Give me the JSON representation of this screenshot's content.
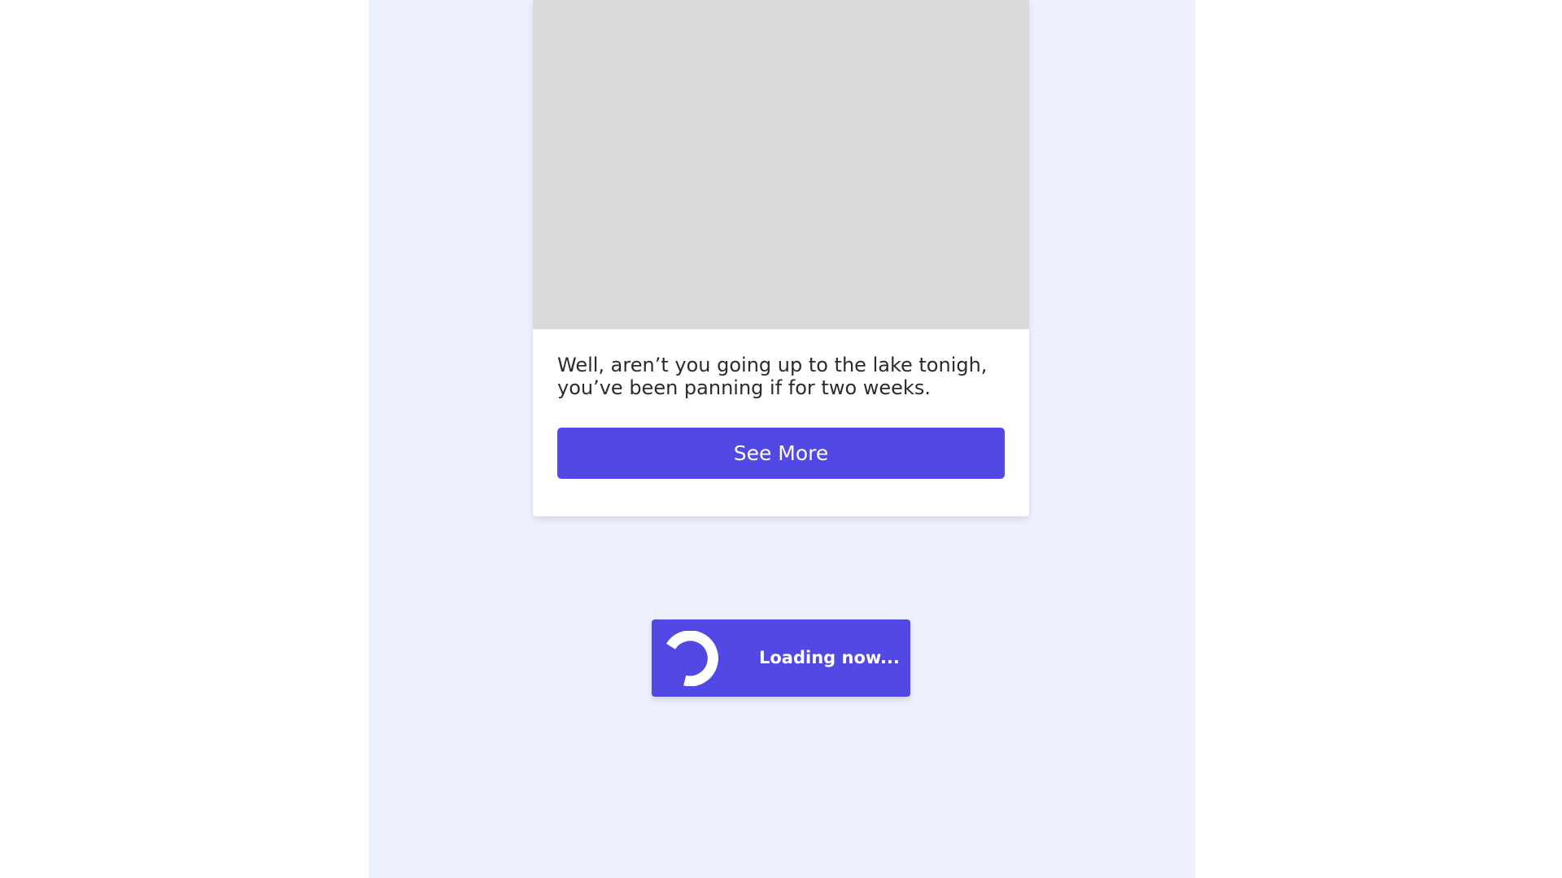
{
  "card": {
    "image_placeholder": "",
    "text": "Well, aren’t you going up to the lake tonigh, you’ve been panning if for two weeks.",
    "button_label": "See More"
  },
  "loading": {
    "label": "Loading now...",
    "icon": "spinner-icon"
  },
  "colors": {
    "page_background": "#ffffff",
    "column_background": "#edf1fd",
    "image_placeholder": "#d9d9d9",
    "accent": "#5249e5",
    "button_text": "#ffffff",
    "body_text": "#2b2b2b"
  }
}
